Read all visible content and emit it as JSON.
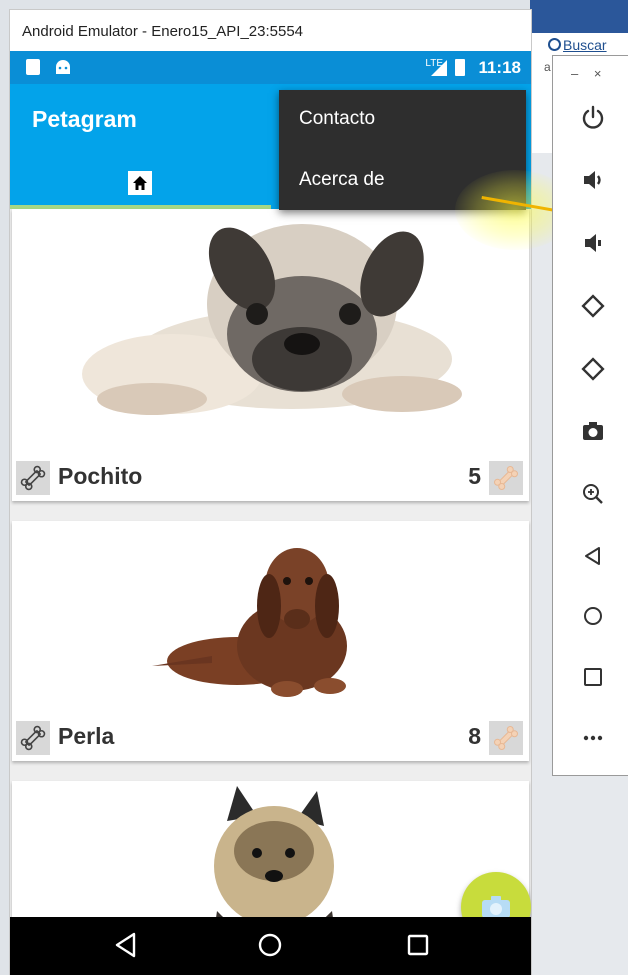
{
  "window": {
    "title": "Android Emulator - Enero15_API_23:5554"
  },
  "desktop": {
    "search_label": "Buscar",
    "side_letter": "a"
  },
  "statusbar": {
    "network": "LTE",
    "time": "11:18"
  },
  "app": {
    "title": "Petagram"
  },
  "menu": {
    "items": [
      {
        "label": "Contacto"
      },
      {
        "label": "Acerca de"
      }
    ]
  },
  "pets": [
    {
      "name": "Pochito",
      "likes": "5"
    },
    {
      "name": "Perla",
      "likes": "8"
    },
    {
      "name": "",
      "likes": ""
    }
  ],
  "panel": {
    "window_controls": "– ×",
    "controls": [
      "power-icon",
      "volume-up-icon",
      "volume-down-icon",
      "rotate-left-icon",
      "rotate-right-icon",
      "camera-icon",
      "zoom-icon",
      "back-icon",
      "home-icon",
      "overview-icon",
      "more-icon"
    ]
  },
  "colors": {
    "appbar": "#03a3ea",
    "statusbar": "#0a8ed6",
    "tab_indicator": "#a6d785",
    "fab": "#c8dc3c",
    "menu": "#2e2e2e"
  }
}
